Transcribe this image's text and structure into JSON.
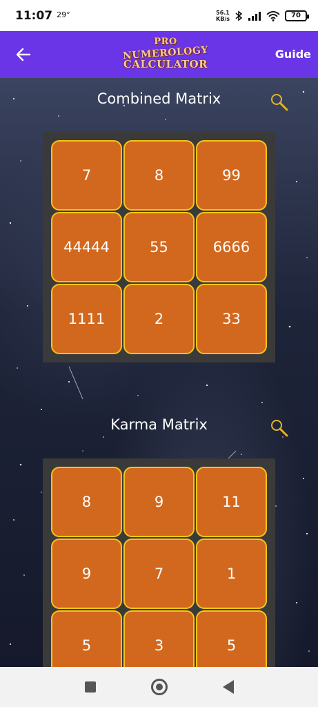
{
  "status_bar": {
    "time": "11:07",
    "temperature": "29°",
    "net_speed": "56.1",
    "net_unit": "KB/s",
    "battery": "70"
  },
  "app_bar": {
    "logo_line1": "PRO",
    "logo_line2": "NUMEROLOGY",
    "logo_line3": "CALCULATOR",
    "guide_label": "Guide",
    "background_color": "#6a35e6"
  },
  "combined_matrix": {
    "title": "Combined Matrix",
    "cells": [
      "7",
      "8",
      "99",
      "44444",
      "55",
      "6666",
      "1111",
      "2",
      "33"
    ]
  },
  "karma_matrix": {
    "title": "Karma Matrix",
    "cells": [
      "8",
      "9",
      "11",
      "9",
      "7",
      "1",
      "5",
      "3",
      "5"
    ]
  },
  "colors": {
    "cell_fill": "#d2681e",
    "cell_border": "#f5c518",
    "matrix_frame": "#3a3a3a"
  },
  "icons": {
    "back": "arrow-left-icon",
    "zoom": "magnifier-icon"
  }
}
